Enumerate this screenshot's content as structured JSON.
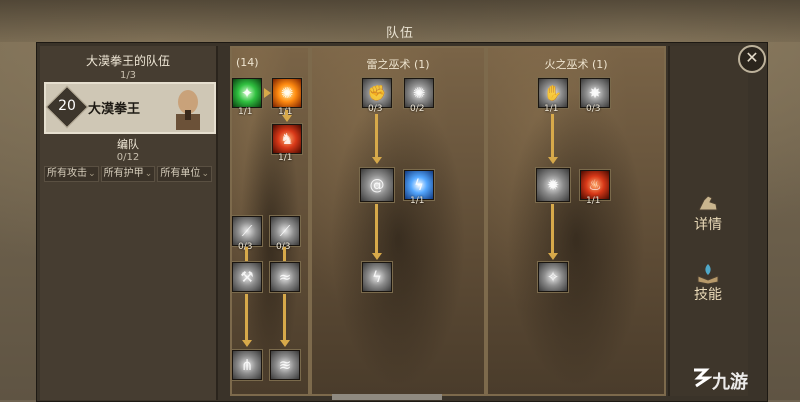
{
  "header": {
    "title": "队伍"
  },
  "left_panel": {
    "team_title": "大漠拳王的队伍",
    "team_count": "1/3",
    "hero": {
      "level": "20",
      "name": "大漠拳王"
    },
    "formation_title": "编队",
    "formation_count": "0/12",
    "filters": [
      {
        "label": "所有攻击"
      },
      {
        "label": "所有护甲"
      },
      {
        "label": "所有单位"
      }
    ]
  },
  "tree_partial": {
    "title_fragment": "(14)",
    "skills": [
      {
        "icon": "green-burst-icon",
        "count": "1/1"
      },
      {
        "icon": "fire-swirl-icon",
        "count": "1/1"
      },
      {
        "icon": "red-beast-icon",
        "count": "1/1"
      },
      {
        "icon": "slash-icon",
        "count": "0/3"
      },
      {
        "icon": "wind-slash-icon",
        "count": "0/3"
      },
      {
        "icon": "hammer-icon",
        "count": ""
      },
      {
        "icon": "wave-icon",
        "count": ""
      },
      {
        "icon": "claw-icon",
        "count": ""
      },
      {
        "icon": "gust-icon",
        "count": ""
      }
    ]
  },
  "tree_thunder": {
    "title": "雷之巫术 (1)",
    "skills": [
      {
        "icon": "thunder-fist-icon",
        "count": "0/3"
      },
      {
        "icon": "vortex-icon",
        "count": "0/2"
      },
      {
        "icon": "spiral-icon",
        "count": ""
      },
      {
        "icon": "lightning-man-icon",
        "count": "1/1"
      },
      {
        "icon": "bolt-icon",
        "count": ""
      }
    ]
  },
  "tree_fire": {
    "title": "火之巫术 (1)",
    "skills": [
      {
        "icon": "flame-hand-icon",
        "count": "1/1"
      },
      {
        "icon": "explosion-icon",
        "count": "0/3"
      },
      {
        "icon": "flame-swirl-icon",
        "count": ""
      },
      {
        "icon": "fire-demon-icon",
        "count": "1/1"
      },
      {
        "icon": "spark-icon",
        "count": ""
      }
    ]
  },
  "side": {
    "details_label": "详情",
    "skills_label": "技能",
    "close_symbol": "✕"
  },
  "watermark": {
    "text": "九游"
  },
  "colors": {
    "link": "#d7a94a",
    "panel_border": "#7d6a4c"
  }
}
